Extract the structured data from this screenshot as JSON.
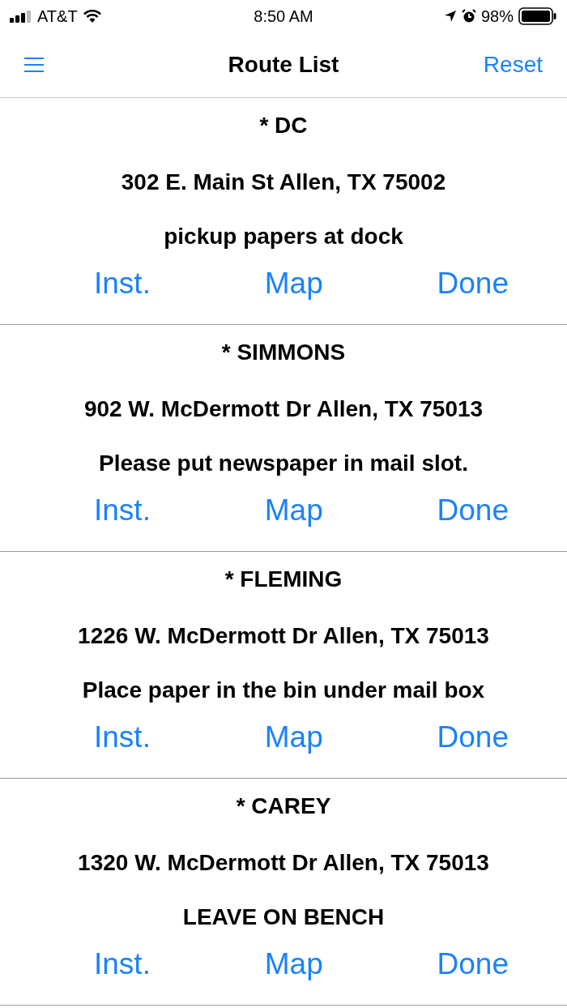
{
  "status_bar": {
    "carrier": "AT&T",
    "time": "8:50 AM",
    "battery": "98%"
  },
  "nav_bar": {
    "title": "Route List",
    "action": "Reset"
  },
  "stops": [
    {
      "name": "* DC",
      "address": "302 E. Main St Allen, TX 75002",
      "note": "pickup papers at dock",
      "actions": [
        "Inst.",
        "Map",
        "Done"
      ]
    },
    {
      "name": "* SIMMONS",
      "address": "902 W. McDermott Dr Allen, TX 75013",
      "note": "Please put newspaper in mail slot.",
      "actions": [
        "Inst.",
        "Map",
        "Done"
      ]
    },
    {
      "name": "* FLEMING",
      "address": "1226 W. McDermott Dr Allen, TX 75013",
      "note": "Place paper in the bin under mail box",
      "actions": [
        "Inst.",
        "Map",
        "Done"
      ]
    },
    {
      "name": "* CAREY",
      "address": "1320 W. McDermott Dr Allen, TX 75013",
      "note": "LEAVE ON BENCH",
      "actions": [
        "Inst.",
        "Map",
        "Done"
      ]
    }
  ]
}
